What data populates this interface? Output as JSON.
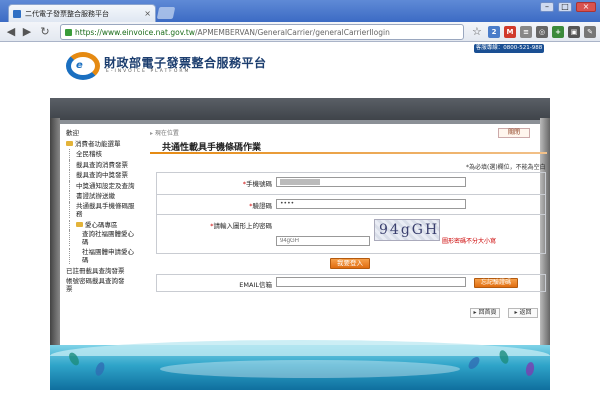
{
  "browser": {
    "tab_title": "二代電子發票整合服務平台",
    "tab_close": "×",
    "url_host": "https://www.einvoice.nat.gov.tw",
    "url_path": "/APMEMBERVAN/GeneralCarrier/generalCarrierIlogin",
    "window_buttons": {
      "minimize": "–",
      "maximize": "□",
      "close": "×"
    },
    "ext_badge_count": "2",
    "icons": [
      "back-icon",
      "forward-icon",
      "reload-icon",
      "lock-icon",
      "star-icon",
      "wrench-icon"
    ]
  },
  "header": {
    "title": "財政部電子發票整合服務平台",
    "subtitle": "E-INVOICE PLATFORM",
    "hotline": "客服專線：0800-521-988"
  },
  "sidebar": {
    "root": "歡迎",
    "items": [
      {
        "label": "消費者功能選單",
        "level": 0,
        "folder": true
      },
      {
        "label": "全民稽核",
        "level": 1
      },
      {
        "label": "載具查詢消費發票",
        "level": 1
      },
      {
        "label": "載具查詢中獎發票",
        "level": 1
      },
      {
        "label": "中獎通知設定及查詢",
        "level": 1
      },
      {
        "label": "書證試辦送繳",
        "level": 1
      },
      {
        "label": "共通載具手機條碼服務",
        "level": 1,
        "wrap": true
      },
      {
        "label": "愛心碼專區",
        "level": 1,
        "folder": true
      },
      {
        "label": "查詢社福團體愛心碼",
        "level": 2,
        "wrap": true
      },
      {
        "label": "社福團體申請愛心碼",
        "level": 2,
        "wrap": true
      },
      {
        "label": "已註冊載具查詢發票",
        "level": 0
      },
      {
        "label": "帳號密碼載具查詢發票",
        "level": 0,
        "wrap": true
      }
    ]
  },
  "main": {
    "breadcrumb": "現在位置",
    "close_label": "關閉",
    "title": "共通性載具手機條碼作業",
    "required_note": "*為必填(選)欄位，不能為空白",
    "fields": {
      "phone": {
        "req": "*",
        "label": "手機號碼"
      },
      "verify_code": {
        "req": "*",
        "label": "驗證碼",
        "value": "••••"
      },
      "captcha": {
        "req": "*",
        "label": "請輸入圖形上的密碼",
        "placeholder": "94gGH",
        "image_text": "94gGH",
        "hint": "圖形密碼不分大小寫"
      },
      "email": {
        "label": "EMAIL信箱"
      }
    },
    "login_button": "我要登入",
    "forgot_button": "忘記驗證碼",
    "home_button": "回首頁",
    "back_button": "返回"
  }
}
